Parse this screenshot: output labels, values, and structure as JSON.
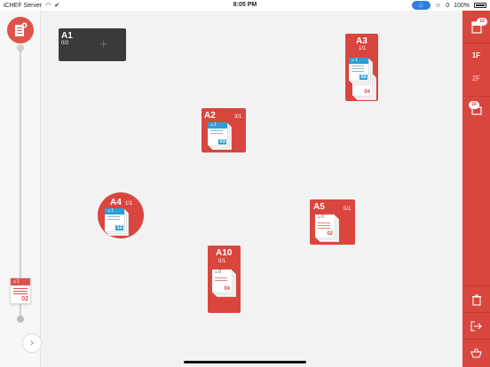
{
  "status_bar": {
    "carrier": "iCHEF Server",
    "time": "8:05 PM",
    "pill_label": "",
    "people_count": "0",
    "battery": "100%"
  },
  "left_rail": {
    "pending_ticket": {
      "guests": "1",
      "number": "02"
    },
    "expand_icon": "chevron-right-icon"
  },
  "tables": [
    {
      "name": "A1",
      "occupancy": "0/2",
      "state": "empty"
    },
    {
      "name": "A2",
      "occupancy": "3/1",
      "state": "occupied",
      "ticket_guests": "1",
      "ticket_number": "03"
    },
    {
      "name": "A3",
      "occupancy": "1/1",
      "state": "occupied",
      "ticket_guests": "1",
      "ticket_number": "02",
      "second_ticket_number": "04"
    },
    {
      "name": "A4",
      "occupancy": "1/1",
      "state": "occupied",
      "ticket_guests": "1",
      "ticket_number": "12"
    },
    {
      "name": "A5",
      "occupancy": "0/1",
      "state": "occupied",
      "ticket_guests": "0",
      "ticket_number": "02"
    },
    {
      "name": "A10",
      "occupancy": "0/1",
      "state": "occupied",
      "ticket_guests": "0",
      "ticket_number": "04"
    }
  ],
  "right_rail": {
    "orders_badge": "19",
    "floor_1": "1F",
    "floor_2": "2F",
    "takeout_badge": "16"
  },
  "colors": {
    "accent": "#d9463e",
    "ticket_blue": "#2b9fd6",
    "empty_table": "#3a3a3a"
  }
}
